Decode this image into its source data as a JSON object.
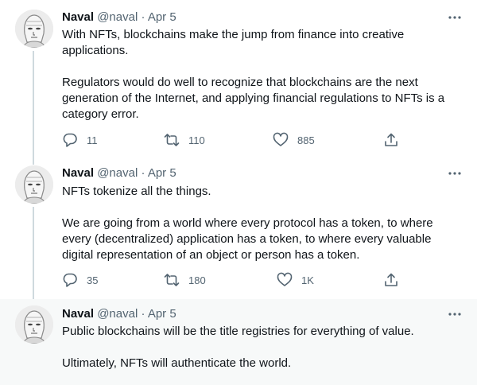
{
  "tweets": [
    {
      "name": "Naval",
      "handle": "@naval",
      "separator": "·",
      "date": "Apr 5",
      "paragraphs": [
        "With NFTs, blockchains make the jump from finance into creative applications.",
        "Regulators would do well to recognize that blockchains are the next generation of the Internet, and applying financial regulations to NFTs is a category error."
      ],
      "replies": "11",
      "retweets": "110",
      "likes": "885"
    },
    {
      "name": "Naval",
      "handle": "@naval",
      "separator": "·",
      "date": "Apr 5",
      "paragraphs": [
        "NFTs tokenize all the things.",
        "We are going from a world where every protocol has a token, to where every (decentralized) application has a token, to where every valuable digital representation of an object or person has a token."
      ],
      "replies": "35",
      "retweets": "180",
      "likes": "1K"
    },
    {
      "name": "Naval",
      "handle": "@naval",
      "separator": "·",
      "date": "Apr 5",
      "paragraphs": [
        "Public blockchains will be the title registries for everything of value.",
        "Ultimately, NFTs will authenticate the world."
      ],
      "replies": "",
      "retweets": "",
      "likes": ""
    }
  ],
  "icons": {
    "reply": "reply-icon",
    "retweet": "retweet-icon",
    "like": "heart-icon",
    "share": "share-icon",
    "more": "more-icon"
  },
  "colors": {
    "text": "#0f1419",
    "muted": "#536471",
    "thread_line": "#cfd9de",
    "highlight_bg": "#f7f9f9"
  }
}
